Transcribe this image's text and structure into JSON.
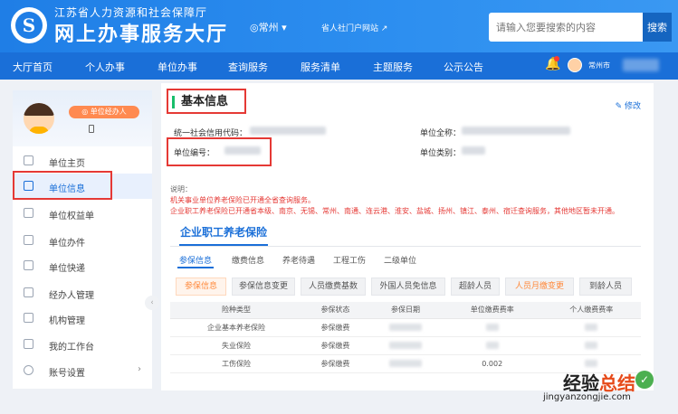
{
  "header": {
    "org_sub": "江苏省人力资源和社会保障厅",
    "org_title": "网上办事服务大厅",
    "city": "◎常州 ▾",
    "personal_link": "省人社门户网站 ↗",
    "search_placeholder": "请输入您要搜索的内容",
    "search_button": "搜索",
    "logo_char": "S"
  },
  "nav": {
    "items": [
      "大厅首页",
      "个人办事",
      "单位办事",
      "查询服务",
      "服务清单",
      "主题服务",
      "公示公告"
    ],
    "user_city": "常州市"
  },
  "sidebar": {
    "role_badge": "◎ 单位经办人",
    "items": [
      {
        "label": "单位主页",
        "icon": "home-icon"
      },
      {
        "label": "单位信息",
        "icon": "info-icon"
      },
      {
        "label": "单位权益单",
        "icon": "badge-icon"
      },
      {
        "label": "单位办件",
        "icon": "file-icon"
      },
      {
        "label": "单位快递",
        "icon": "parcel-icon"
      },
      {
        "label": "经办人管理",
        "icon": "user-icon"
      },
      {
        "label": "机构管理",
        "icon": "building-icon"
      },
      {
        "label": "我的工作台",
        "icon": "desk-icon"
      },
      {
        "label": "账号设置",
        "icon": "gear-icon"
      }
    ],
    "collapse": "‹"
  },
  "main": {
    "section_title": "基本信息",
    "edit_link": "✎ 修改",
    "fields": {
      "credit_code": "统一社会信用代码：",
      "unit_name": "单位全称：",
      "unit_number": "单位编号：",
      "unit_type": "单位类别："
    },
    "notes": {
      "title": "说明：",
      "line1": "机关事业单位养老保险已开通全省查询服务。",
      "line2": "企业职工养老保险已开通省本级、南京、无锡、常州、南通、连云港、淮安、盐城、扬州、镇江、泰州、宿迁查询服务，其他地区暂未开通。"
    },
    "main_tab": "企业职工养老保险",
    "subtabs": [
      "参保信息",
      "缴费信息",
      "养老待遇",
      "工程工伤",
      "二级单位"
    ],
    "pills": [
      "参保信息",
      "参保信息变更",
      "人员缴费基数",
      "外国人员免信息",
      "超龄人员",
      "人员月缴变更",
      "到龄人员"
    ],
    "table": {
      "headers": [
        "险种类型",
        "参保状态",
        "参保日期",
        "单位缴费费率",
        "个人缴费费率"
      ],
      "rows": [
        {
          "type": "企业基本养老保险",
          "status": "参保缴费",
          "rate": ""
        },
        {
          "type": "失业保险",
          "status": "参保缴费",
          "rate": ""
        },
        {
          "type": "工伤保险",
          "status": "参保缴费",
          "rate": "0.002"
        }
      ]
    }
  },
  "watermark": {
    "main_a": "经验",
    "main_b": "总结",
    "url": "jingyanzongjie.com",
    "check": "✓"
  },
  "colors": {
    "primary": "#1f7ee6",
    "nav": "#1a6fd8",
    "accent_orange": "#ff8a3d",
    "highlight_red": "#e53935",
    "title_bar_green": "#19be6b"
  }
}
